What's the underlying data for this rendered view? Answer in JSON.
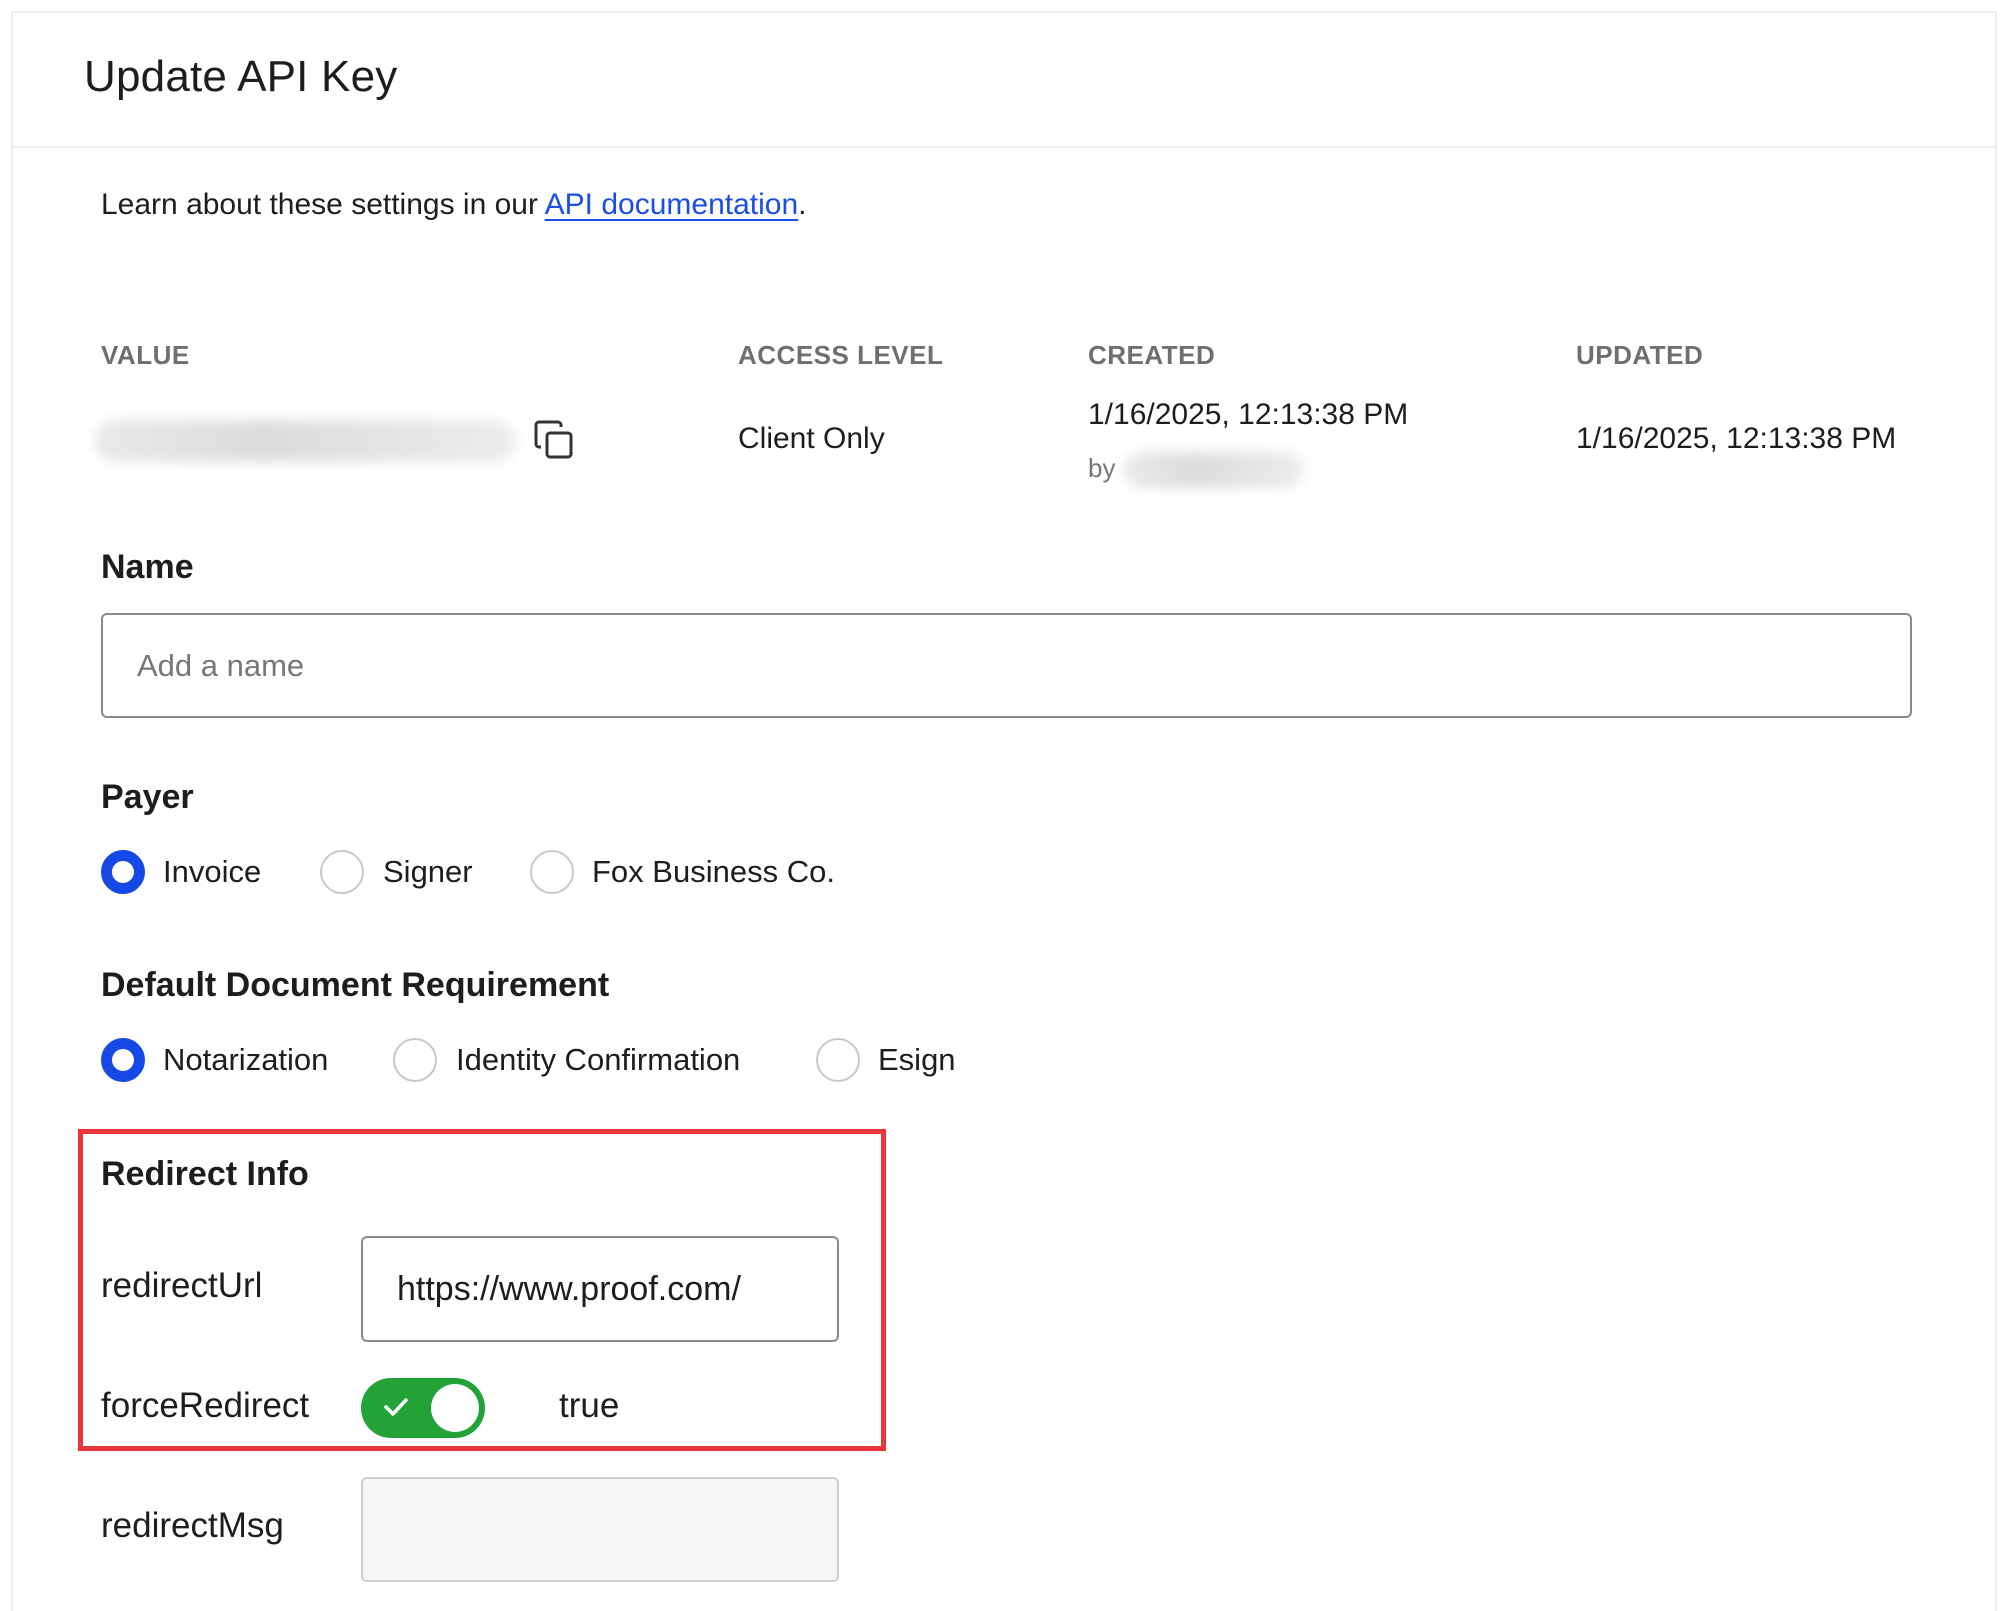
{
  "page": {
    "title": "Update API Key"
  },
  "intro": {
    "prefix": "Learn about these settings in our ",
    "link_text": "API documentation",
    "suffix": "."
  },
  "details": {
    "headers": {
      "value": "VALUE",
      "access_level": "ACCESS LEVEL",
      "created": "CREATED",
      "updated": "UPDATED"
    },
    "access_level": "Client Only",
    "created_at": "1/16/2025, 12:13:38 PM",
    "created_by_prefix": "by",
    "updated_at": "1/16/2025, 12:13:38 PM"
  },
  "name_field": {
    "label": "Name",
    "placeholder": "Add a name",
    "value": ""
  },
  "payer": {
    "label": "Payer",
    "options": [
      {
        "label": "Invoice",
        "checked": true
      },
      {
        "label": "Signer",
        "checked": false
      },
      {
        "label": "Fox Business Co.",
        "checked": false
      }
    ]
  },
  "document_requirement": {
    "label": "Default Document Requirement",
    "options": [
      {
        "label": "Notarization",
        "checked": true
      },
      {
        "label": "Identity Confirmation",
        "checked": false
      },
      {
        "label": "Esign",
        "checked": false
      }
    ]
  },
  "redirect": {
    "title": "Redirect Info",
    "url_label": "redirectUrl",
    "url_value": "https://www.proof.com/",
    "force_label": "forceRedirect",
    "force_value": "true",
    "msg_label": "redirectMsg",
    "msg_value": ""
  },
  "colors": {
    "accent": "#1648e6",
    "link": "#1a4ee6",
    "toggle_on": "#22a237",
    "highlight": "#e8363a"
  }
}
